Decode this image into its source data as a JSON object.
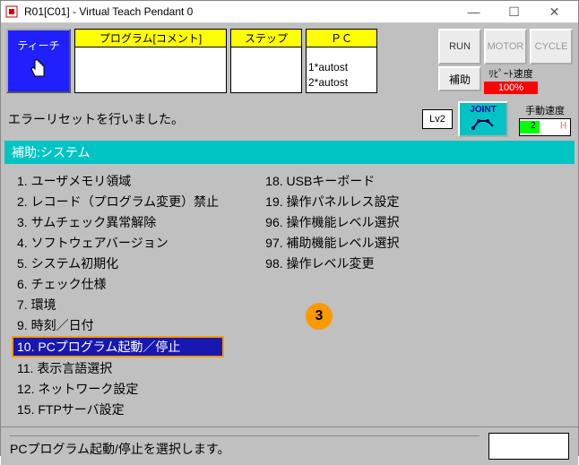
{
  "titlebar": {
    "title": "R01[C01] - Virtual Teach Pendant 0"
  },
  "toolbar": {
    "teach_label": "ティーチ",
    "program_header": "プログラム[コメント]",
    "step_header": "ステップ",
    "pc_header": "ＰＣ",
    "pc_body": [
      "1*autost",
      "2*autost"
    ],
    "run_label": "RUN",
    "motor_label": "MOTOR",
    "cycle_label": "CYCLE",
    "aux_label": "補助",
    "repeat_speed_label": "ﾘﾋﾟｰﾄ速度",
    "repeat_speed_value": "100%"
  },
  "message_row": {
    "text": "エラーリセットを行いました。",
    "lv_label": "Lv2",
    "joint_label": "JOINT",
    "manual_speed_label": "手動速度",
    "manual_value": "2"
  },
  "section": {
    "header": "補助:システム"
  },
  "menu_left": [
    {
      "num": "1.",
      "label": "ユーザメモリ領域"
    },
    {
      "num": "2.",
      "label": "レコード（プログラム変更）禁止"
    },
    {
      "num": "3.",
      "label": "サムチェック異常解除"
    },
    {
      "num": "4.",
      "label": "ソフトウェアバージョン"
    },
    {
      "num": "5.",
      "label": "システム初期化"
    },
    {
      "num": "6.",
      "label": "チェック仕様"
    },
    {
      "num": "7.",
      "label": "環境"
    },
    {
      "num": "9.",
      "label": "時刻／日付"
    },
    {
      "num": "10.",
      "label": "PCプログラム起動／停止",
      "selected": true
    },
    {
      "num": "11.",
      "label": "表示言語選択"
    },
    {
      "num": "12.",
      "label": "ネットワーク設定"
    },
    {
      "num": "15.",
      "label": "FTPサーバ設定"
    }
  ],
  "menu_right": [
    {
      "num": "18.",
      "label": "USBキーボード"
    },
    {
      "num": "19.",
      "label": "操作パネルレス設定"
    },
    {
      "num": "96.",
      "label": "操作機能レベル選択"
    },
    {
      "num": "97.",
      "label": "補助機能レベル選択"
    },
    {
      "num": "98.",
      "label": "操作レベル変更"
    }
  ],
  "annotation": {
    "number": "3"
  },
  "status": {
    "text": "PCプログラム起動/停止を選択します。"
  }
}
